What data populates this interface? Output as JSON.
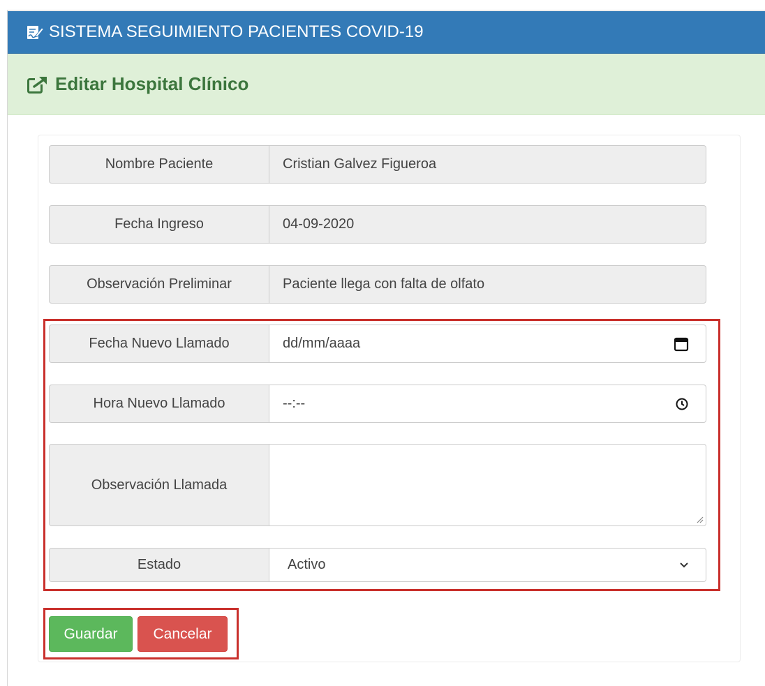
{
  "app": {
    "title": "SISTEMA SEGUIMIENTO PACIENTES COVID-19",
    "header_icon": "signature-document-icon",
    "colors": {
      "primary": "#337ab7",
      "success_bg": "#dff0d8",
      "success_text": "#3c763d",
      "danger": "#d9534f",
      "success": "#5cb85c",
      "highlight_border": "#c9302c"
    }
  },
  "page": {
    "heading": "Editar Hospital Clínico",
    "heading_icon": "external-edit-icon"
  },
  "form": {
    "patient_name": {
      "label": "Nombre Paciente",
      "value": "Cristian Galvez Figueroa"
    },
    "admission_date": {
      "label": "Fecha Ingreso",
      "value": "04-09-2020"
    },
    "preliminary_observation": {
      "label": "Observación Preliminar",
      "value": "Paciente llega con falta de olfato"
    },
    "new_call_date": {
      "label": "Fecha Nuevo Llamado",
      "value": "dd/mm/aaaa",
      "icon": "calendar-icon"
    },
    "new_call_time": {
      "label": "Hora Nuevo Llamado",
      "value": "--:--",
      "icon": "clock-icon"
    },
    "call_observation": {
      "label": "Observación Llamada",
      "value": ""
    },
    "status": {
      "label": "Estado",
      "selected": "Activo",
      "icon": "chevron-down-icon"
    }
  },
  "actions": {
    "save_label": "Guardar",
    "cancel_label": "Cancelar"
  }
}
